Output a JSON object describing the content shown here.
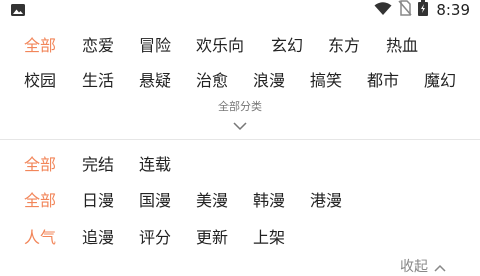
{
  "status_bar": {
    "time": "8:39",
    "icons": [
      "image-icon",
      "wifi-icon",
      "no-sim-icon",
      "battery-charging-icon"
    ]
  },
  "categories": {
    "row1": [
      "全部",
      "恋爱",
      "冒险",
      "欢乐向",
      "玄幻",
      "东方",
      "热血"
    ],
    "row2": [
      "校园",
      "生活",
      "悬疑",
      "治愈",
      "浪漫",
      "搞笑",
      "都市",
      "魔幻"
    ],
    "expand_label": "全部分类"
  },
  "filters": {
    "status": [
      "全部",
      "完结",
      "连载"
    ],
    "region": [
      "全部",
      "日漫",
      "国漫",
      "美漫",
      "韩漫",
      "港漫"
    ],
    "sort": [
      "人气",
      "追漫",
      "评分",
      "更新",
      "上架"
    ]
  },
  "collapse_label": "收起",
  "colors": {
    "active": "#f2865a",
    "text": "#222222"
  }
}
